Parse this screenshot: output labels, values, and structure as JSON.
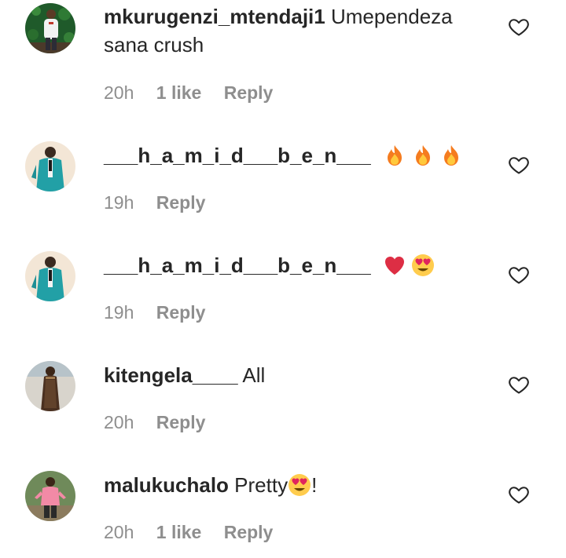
{
  "comments": [
    {
      "username": "mkurugenzi_mtendaji1",
      "text": "Umependeza sana crush",
      "time": "20h",
      "likes": "1 like",
      "reply": "Reply",
      "avatar": "avatar-photo-man-green-backdrop"
    },
    {
      "username": "___h_a_m_i_d___b_e_n___",
      "text": "",
      "emojis": [
        "fire-emoji",
        "fire-emoji",
        "fire-emoji"
      ],
      "time": "19h",
      "reply": "Reply",
      "avatar": "avatar-photo-man-teal-suit"
    },
    {
      "username": "___h_a_m_i_d___b_e_n___",
      "text": "",
      "emojis": [
        "red-heart-emoji",
        "heart-eyes-emoji"
      ],
      "time": "19h",
      "reply": "Reply",
      "avatar": "avatar-photo-man-teal-suit"
    },
    {
      "username": "kitengela____",
      "text": "All",
      "time": "20h",
      "reply": "Reply",
      "avatar": "avatar-photo-woman-dress"
    },
    {
      "username": "malukuchalo",
      "text_before": "Pretty",
      "text_after": "!",
      "emojis": [
        "heart-eyes-emoji"
      ],
      "time": "20h",
      "likes": "1 like",
      "reply": "Reply",
      "avatar": "avatar-photo-person-pink-hoodie"
    }
  ],
  "colors": {
    "text_primary": "#262626",
    "text_secondary": "#8e8e8e",
    "background": "#ffffff"
  },
  "icons": {
    "like": "heart-outline-icon"
  }
}
